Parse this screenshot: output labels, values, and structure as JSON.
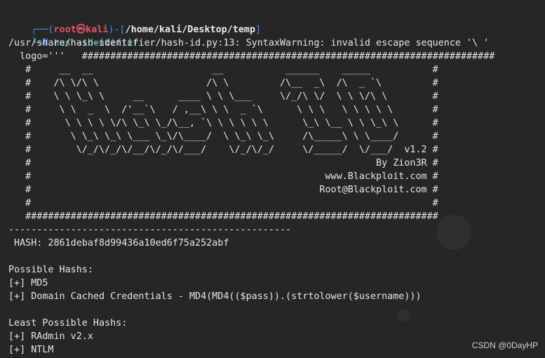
{
  "prompt": {
    "corner_top": "┌──(",
    "user": "root",
    "at": "㉿",
    "host": "kali",
    "path_open": ")-[",
    "path": "/home/kali/Desktop/temp",
    "path_close": "]",
    "corner_bottom": "└─",
    "hash_symbol": "#",
    "command": "hash-identifier"
  },
  "warning": "/usr/share/hash-identifier/hash-id.py:13: SyntaxWarning: invalid escape sequence '\\ '",
  "logo_lines": [
    "  logo='''   #########################################################################",
    "   #########################################################################",
    "   #     __  __                     __           ______    _____           #",
    "   #    /\\ \\/\\ \\                   /\\ \\         /\\__  _\\  /\\  _ `\\         #",
    "   #    \\ \\ \\_\\ \\     __      ____ \\ \\ \\___     \\/_/\\ \\/  \\ \\ \\/\\ \\        #",
    "   #     \\ \\  _  \\  /'__`\\   / ,__\\ \\ \\  _ `\\      \\ \\ \\   \\ \\ \\ \\ \\       #",
    "   #      \\ \\ \\ \\ \\/\\ \\_\\ \\_/\\__, `\\ \\ \\ \\ \\ \\      \\_\\ \\__ \\ \\ \\_\\ \\      #",
    "   #       \\ \\_\\ \\_\\ \\___ \\_\\/\\____/  \\ \\_\\ \\_\\     /\\_____\\ \\ \\____/      #",
    "   #        \\/_/\\/_/\\/__/\\/_/\\/___/    \\/_/\\/_/     \\/_____/  \\/___/  v1.2 #",
    "   #                                                             By Zion3R #",
    "   #                                                    www.Blackploit.com #",
    "   #                                                   Root@Blackploit.com #",
    "   #                                                                       #",
    "   #########################################################################"
  ],
  "separator": "--------------------------------------------------",
  "hash_line": " HASH: 2861debaf8d99436a10ed6f75a252abf",
  "possible_header": "Possible Hashs:",
  "possible_items": [
    "[+] MD5",
    "[+] Domain Cached Credentials - MD4(MD4(($pass)).(strtolower($username)))"
  ],
  "least_header": "Least Possible Hashs:",
  "least_items": [
    "[+] RAdmin v2.x",
    "[+] NTLM"
  ],
  "watermark": "CSDN @0DayHP",
  "colors": {
    "background": "#262626",
    "text": "#e6e6e6",
    "prompt_frame": "#3b8eea",
    "prompt_user": "#e05561",
    "prompt_path": "#4f8cff"
  }
}
